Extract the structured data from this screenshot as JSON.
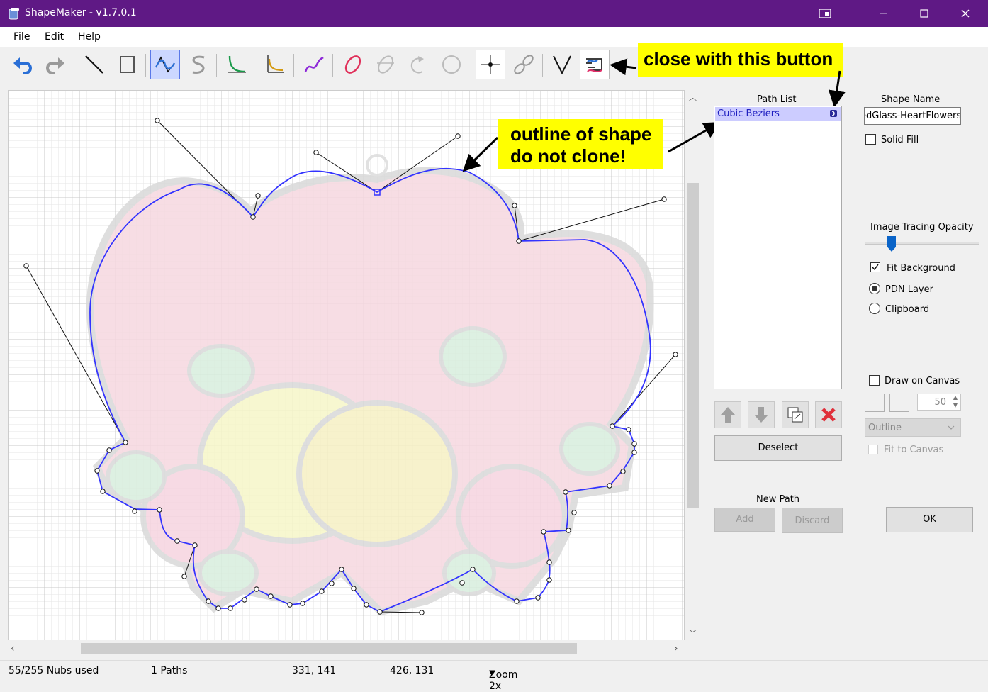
{
  "window": {
    "title": "ShapeMaker - v1.7.0.1"
  },
  "menu": {
    "items": [
      "File",
      "Edit",
      "Help"
    ]
  },
  "toolbar": {
    "buttons": [
      "undo-icon",
      "redo-icon",
      "straight-line-icon",
      "rectangle-icon",
      "cubic-bezier-icon",
      "smooth-cubic-bezier-icon",
      "quadratic-bezier-icon",
      "smooth-quadratic-bezier-icon",
      "spline-icon",
      "ellipse-icon",
      "arc-icon",
      "arc-direction-icon",
      "circle-icon",
      "snap-to-grid-icon",
      "link-paths-icon",
      "mirror-icon",
      "close-path-icon"
    ],
    "active": "cubic-bezier-icon"
  },
  "annotations": {
    "close_button_note": "close with this button",
    "outline_note_line1": "outline of shape",
    "outline_note_line2": "do not clone!"
  },
  "path_list": {
    "label": "Path List",
    "items": [
      "Cubic Beziers"
    ]
  },
  "buttons": {
    "deselect": "Deselect",
    "add": "Add",
    "discard": "Discard",
    "ok": "OK"
  },
  "new_path": {
    "label": "New Path"
  },
  "shape_name": {
    "label": "Shape Name",
    "value": "edGlass-HeartFlowers"
  },
  "options": {
    "solid_fill": "Solid Fill",
    "tracing_label": "Image Tracing Opacity",
    "fit_background": "Fit Background",
    "pdn_layer": "PDN Layer",
    "clipboard": "Clipboard",
    "draw_on_canvas": "Draw on Canvas",
    "brush_width": "50",
    "draw_mode": "Outline",
    "fit_to_canvas": "Fit to Canvas"
  },
  "status": {
    "nubs": "55/255 Nubs used",
    "paths": "1 Paths",
    "coord1": "331, 141",
    "coord2": "426, 131",
    "zoom": "Zoom 2x"
  },
  "colors": {
    "titlebar": "#5f1985",
    "path": "#3333ff",
    "selection": "#ccccff",
    "note": "#ffff00"
  }
}
